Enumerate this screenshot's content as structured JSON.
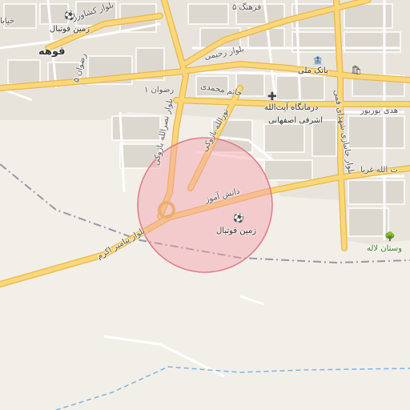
{
  "map": {
    "colors": {
      "background": "#f2efe9",
      "built_area": "#e8e4dc",
      "block": "#ddd8cf",
      "major_road": "#fcd77a",
      "major_road_casing": "#e8b84a",
      "minor_road": "#ffffff",
      "boundary": "#9b96a8",
      "waterway": "#7fb3e0",
      "circle_fill": "#f4a0a8",
      "circle_stroke": "#e07a86"
    },
    "highlight_circle": {
      "type": "radius-overlay"
    },
    "labels": {
      "farhang5": "فرهنگ ۵",
      "keshavarz": "بلوار کشاورز",
      "khayyam": "خیابا",
      "football_1": "زمین فوتبال",
      "ghahveh": "قوهه",
      "rezvan5": "رضوان ۵",
      "rahimi": "بلوار رحیمی",
      "bank_melli": "بانک ملی",
      "rezvan1": "رضوان ۱",
      "khatam": "خاتم محمدی",
      "clinic_1": "درمانگاه آیت‌الله",
      "clinic_2": "اشرفی اصفهانی",
      "nasrollah": "بلوار نصرالله باژوکی",
      "nurollah": "نورالله باژوکی",
      "shahid_gonbad": "بلوار جانبازی شهدای قمی",
      "beheshti": "هدی بوربور",
      "ayatollah": "ت الله غریا",
      "danesh_amuz": "دانش آموز",
      "football_2": "زمین فوتبال",
      "payambar": "بلوار پیامبر اکرم",
      "park": "وستان لاله"
    },
    "icons": {
      "football_1": "football-field-icon",
      "bank": "bank-icon",
      "shop": "shop-icon",
      "clinic": "clinic-icon",
      "football_2": "football-field-icon",
      "park": "park-icon"
    }
  }
}
